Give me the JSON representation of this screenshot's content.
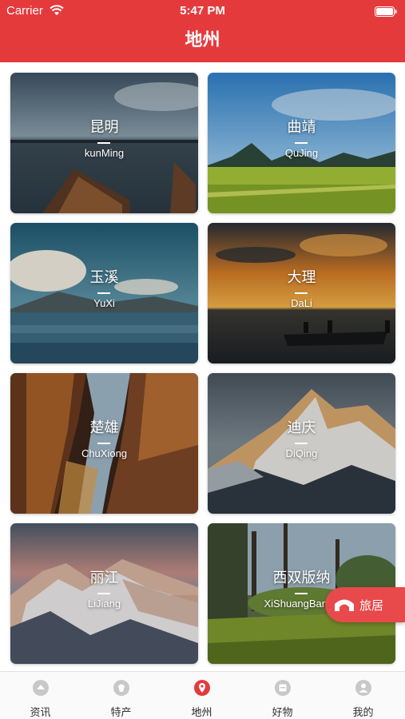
{
  "status_bar": {
    "carrier": "Carrier",
    "time": "5:47 PM"
  },
  "nav": {
    "title": "地州"
  },
  "cities": [
    {
      "name": "昆明",
      "pinyin": "kunMing"
    },
    {
      "name": "曲靖",
      "pinyin": "QuJing"
    },
    {
      "name": "玉溪",
      "pinyin": "YuXi"
    },
    {
      "name": "大理",
      "pinyin": "DaLi"
    },
    {
      "name": "楚雄",
      "pinyin": "ChuXiong"
    },
    {
      "name": "迪庆",
      "pinyin": "DiQing"
    },
    {
      "name": "丽江",
      "pinyin": "LiJiang"
    },
    {
      "name": "西双版纳",
      "pinyin": "XiShuangBanna"
    }
  ],
  "float_button": {
    "label": "旅居"
  },
  "tabs": [
    {
      "label": "资讯",
      "icon": "info-icon"
    },
    {
      "label": "特产",
      "icon": "specialty-icon"
    },
    {
      "label": "地州",
      "icon": "location-pin-icon",
      "active": true
    },
    {
      "label": "好物",
      "icon": "goods-icon"
    },
    {
      "label": "我的",
      "icon": "user-icon"
    }
  ],
  "colors": {
    "brand": "#e43a3c",
    "active_tab": "#e43a3c",
    "inactive_tab": "#c8c8c8"
  }
}
